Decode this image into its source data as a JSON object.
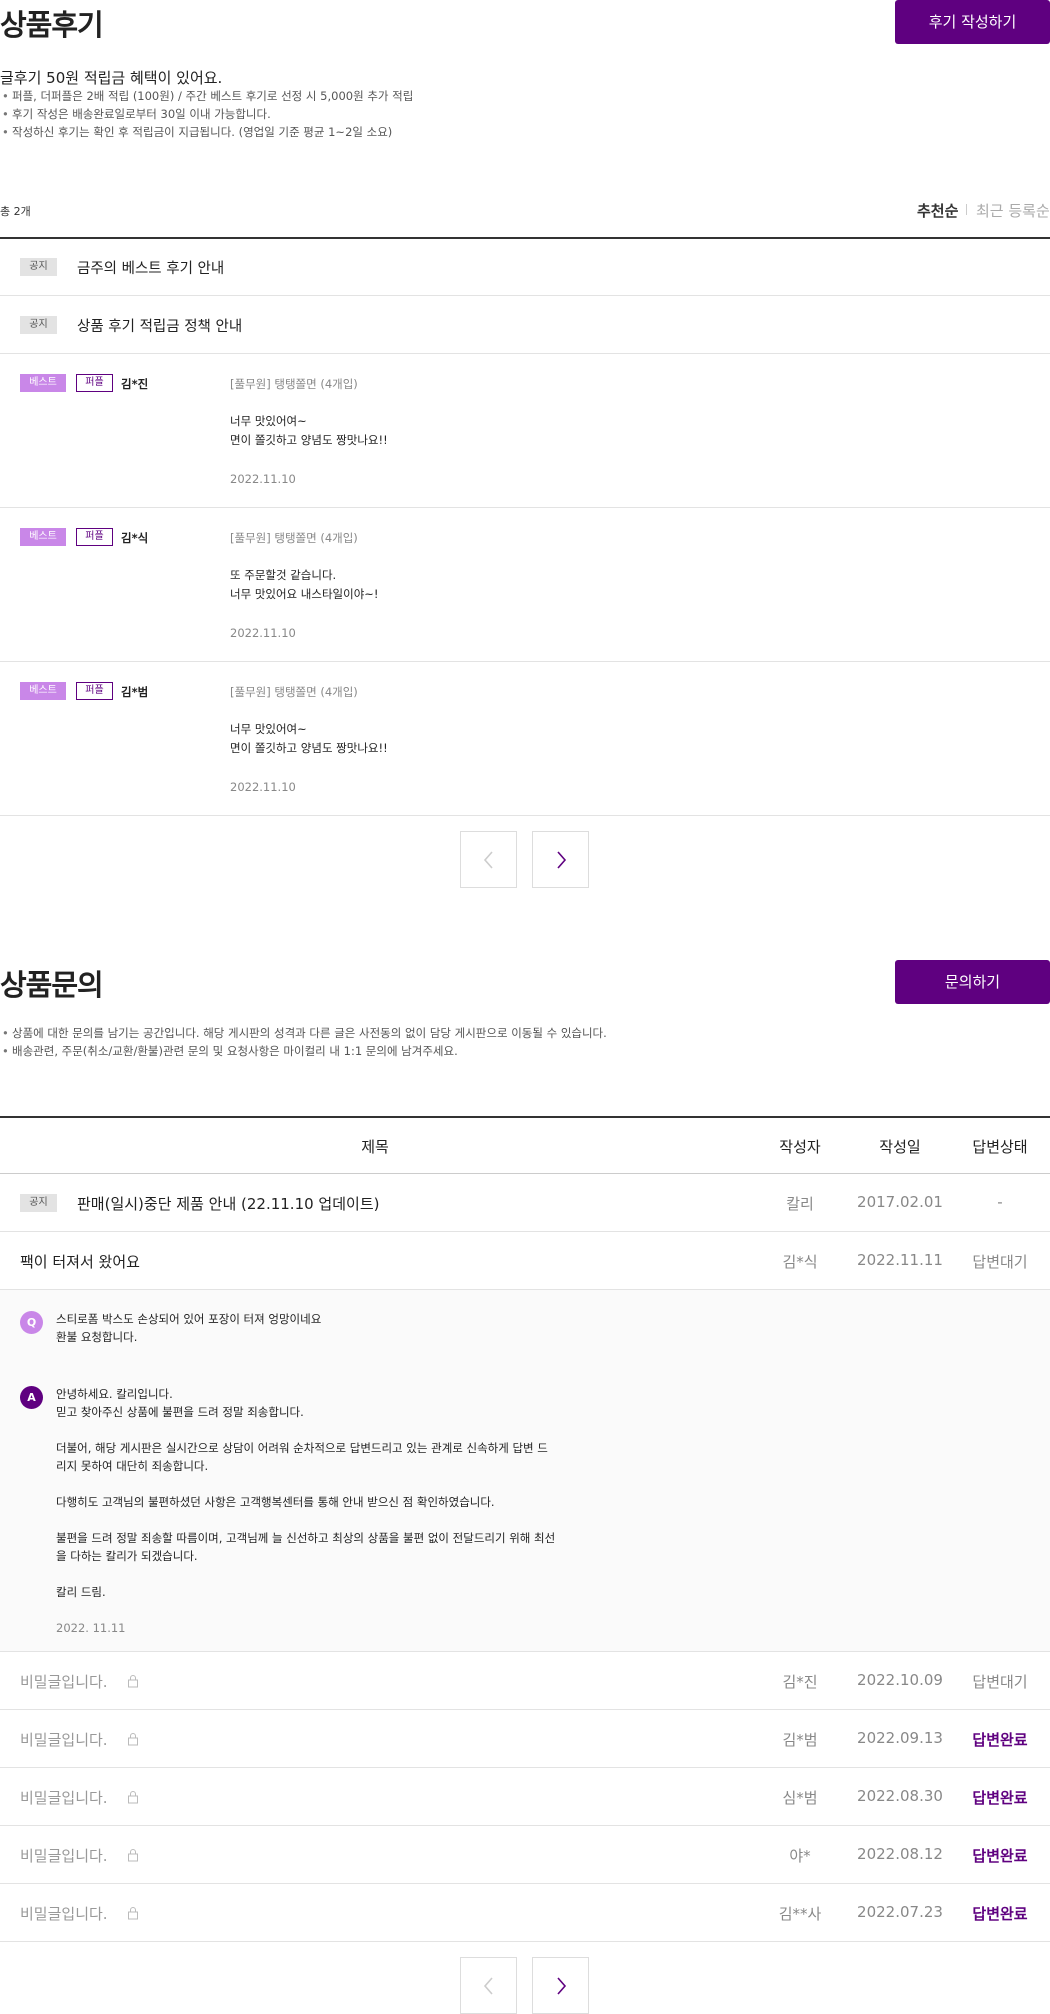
{
  "review": {
    "title": "상품후기",
    "write_button": "후기 작성하기",
    "benefit_head": "글후기 50원 적립금 혜택이 있어요.",
    "benefit_items": [
      "퍼플, 더퍼플은 2배 적립 (100원) / 주간 베스트 후기로 선정 시 5,000원 추가 적립",
      "후기 작성은 배송완료일로부터 30일 이내 가능합니다.",
      "작성하신 후기는 확인 후 적립금이 지급됩니다. (영업일 기준 평균 1~2일 소요)"
    ],
    "total": "총 2개",
    "sort_recommended": "추천순",
    "sort_recent": "최근 등록순",
    "notices": [
      {
        "tag": "공지",
        "title": "금주의 베스트 후기 안내"
      },
      {
        "tag": "공지",
        "title": "상품 후기 적립금 정책 안내"
      }
    ],
    "items": [
      {
        "best": "베스트",
        "grade": "퍼플",
        "author": "김*진",
        "product": "[풀무원] 탱탱쫄면 (4개입)",
        "line1": "너무 맛있어여~",
        "line2": "면이 쫄깃하고 양념도 짱맛나요!!",
        "date": "2022.11.10"
      },
      {
        "best": "베스트",
        "grade": "퍼플",
        "author": "김*식",
        "product": "[풀무원] 탱탱쫄면 (4개입)",
        "line1": "또 주문할것 같습니다.",
        "line2": "너무 맛있어요 내스타일이야~!",
        "date": "2022.11.10"
      },
      {
        "best": "베스트",
        "grade": "퍼플",
        "author": "김*범",
        "product": "[풀무원] 탱탱쫄면 (4개입)",
        "line1": "너무 맛있어여~",
        "line2": "면이 쫄깃하고 양념도 짱맛나요!!",
        "date": "2022.11.10"
      }
    ]
  },
  "inquiry": {
    "title": "상품문의",
    "ask_button": "문의하기",
    "notes": [
      "상품에 대한 문의를 남기는 공간입니다. 해당 게시판의 성격과 다른 글은 사전동의 없이 담당 게시판으로 이동될 수 있습니다.",
      "배송관련, 주문(취소/교환/환불)관련 문의 및 요청사항은 마이컬리 내 1:1 문의에 남겨주세요."
    ],
    "headers": {
      "title": "제목",
      "author": "작성자",
      "date": "작성일",
      "status": "답변상태"
    },
    "notice_row": {
      "tag": "공지",
      "title": "판매(일시)중단 제품 안내 (22.11.10 업데이트)",
      "author": "칼리",
      "date": "2017.02.01",
      "status": "-"
    },
    "open_row": {
      "title": "팩이 터져서 왔어요",
      "author": "김*식",
      "date": "2022.11.11",
      "status": "답변대기"
    },
    "question": {
      "badge": "Q",
      "lines": [
        "스티로폼 박스도 손상되어 있어 포장이 터져 엉망이네요",
        "환불 요청합니다."
      ]
    },
    "answer": {
      "badge": "A",
      "lines": [
        "안녕하세요. 칼리입니다.",
        "믿고 찾아주신 상품에 불편을 드려 정말 죄송합니다.",
        "더불어, 해당 게시판은 실시간으로 상담이 어려워 순차적으로 답변드리고 있는 관계로 신속하게 답변 드",
        "리지 못하여 대단히 죄송합니다.",
        "다행히도 고객님의 불편하셨던 사항은 고객행복센터를 통해 안내 받으신 점 확인하였습니다.",
        "불편을 드려 정말 죄송할 따름이며, 고객님께 늘 신선하고 최상의 상품을 불편 없이 전달드리기 위해 최선",
        "을 다하는 칼리가 되겠습니다.",
        "칼리 드림."
      ],
      "date": "2022. 11.11"
    },
    "secret_rows": [
      {
        "title": "비밀글입니다.",
        "author": "김*진",
        "date": "2022.10.09",
        "status": "답변대기"
      },
      {
        "title": "비밀글입니다.",
        "author": "김*범",
        "date": "2022.09.13",
        "status": "답변완료"
      },
      {
        "title": "비밀글입니다.",
        "author": "심*범",
        "date": "2022.08.30",
        "status": "답변완료"
      },
      {
        "title": "비밀글입니다.",
        "author": "야*",
        "date": "2022.08.12",
        "status": "답변완료"
      },
      {
        "title": "비밀글입니다.",
        "author": "김**사",
        "date": "2022.07.23",
        "status": "답변완료"
      }
    ]
  },
  "colors": {
    "accent": "#5f0080",
    "best_tag": "#c987e8"
  },
  "icons": {
    "prev": "chevron-left-icon",
    "next": "chevron-right-icon",
    "lock": "lock-icon"
  }
}
